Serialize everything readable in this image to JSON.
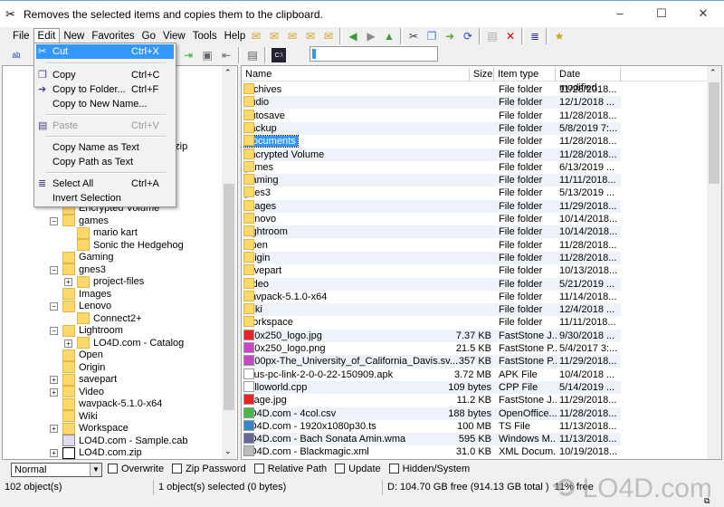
{
  "window": {
    "title": "Removes the selected items and copies them to the clipboard.",
    "minimize": "–",
    "maximize": "☐",
    "close": "✕"
  },
  "menubar": [
    "File",
    "Edit",
    "New",
    "Favorites",
    "Go",
    "View",
    "Tools",
    "Help"
  ],
  "address": {
    "value": ""
  },
  "edit_menu": {
    "items": [
      {
        "label": "Cut",
        "shortcut": "Ctrl+X",
        "icon": "scissors-icon",
        "state": "highlighted"
      },
      {
        "label": "Copy",
        "shortcut": "Ctrl+C",
        "icon": "copy-icon"
      },
      {
        "label": "Copy to Folder...",
        "shortcut": "Ctrl+F",
        "icon": "folder-copy-icon"
      },
      {
        "label": "Copy to New Name...",
        "shortcut": ""
      },
      {
        "label": "Paste",
        "shortcut": "Ctrl+V",
        "icon": "paste-icon",
        "state": "disabled"
      },
      {
        "label": "Copy Name as Text",
        "shortcut": ""
      },
      {
        "label": "Copy Path as Text",
        "shortcut": ""
      },
      {
        "label": "Select All",
        "shortcut": "Ctrl+A",
        "icon": "select-all-icon"
      },
      {
        "label": "Invert Selection",
        "shortcut": ""
      }
    ]
  },
  "tree": {
    "partial_item": "e.zip",
    "items": [
      {
        "label": "Encrypted Volume",
        "level": 1
      },
      {
        "label": "games",
        "level": 1,
        "expander": "−"
      },
      {
        "label": "mario kart",
        "level": 2
      },
      {
        "label": "Sonic the Hedgehog",
        "level": 2
      },
      {
        "label": "Gaming",
        "level": 1
      },
      {
        "label": "gnes3",
        "level": 1,
        "expander": "−"
      },
      {
        "label": "project-files",
        "level": 2,
        "expander": "+"
      },
      {
        "label": "Images",
        "level": 1
      },
      {
        "label": "Lenovo",
        "level": 1,
        "expander": "−"
      },
      {
        "label": "Connect2+",
        "level": 2
      },
      {
        "label": "Lightroom",
        "level": 1,
        "expander": "−"
      },
      {
        "label": "LO4D.com - Catalog",
        "level": 2,
        "expander": "+"
      },
      {
        "label": "Open",
        "level": 1
      },
      {
        "label": "Origin",
        "level": 1
      },
      {
        "label": "savepart",
        "level": 1,
        "expander": "+"
      },
      {
        "label": "Video",
        "level": 1,
        "expander": "+"
      },
      {
        "label": "wavpack-5.1.0-x64",
        "level": 1
      },
      {
        "label": "Wiki",
        "level": 1
      },
      {
        "label": "Workspace",
        "level": 1,
        "expander": "+"
      },
      {
        "label": "LO4D.com - Sample.cab",
        "level": 1,
        "icon": "cab"
      },
      {
        "label": "LO4D.com.zip",
        "level": 1,
        "expander": "+",
        "icon": "7z"
      }
    ]
  },
  "list": {
    "columns": [
      "Name",
      "Size",
      "Item type",
      "Date modified"
    ],
    "rows": [
      [
        "Archives",
        "",
        "File folder",
        "11/28/2018...",
        "folder"
      ],
      [
        "Audio",
        "",
        "File folder",
        "12/1/2018 ...",
        "folder"
      ],
      [
        "Autosave",
        "",
        "File folder",
        "11/28/2018...",
        "folder"
      ],
      [
        "Backup",
        "",
        "File folder",
        "5/8/2019 7:...",
        "folder"
      ],
      [
        "Documents",
        "",
        "File folder",
        "11/28/2018...",
        "folder"
      ],
      [
        "Encrypted Volume",
        "",
        "File folder",
        "11/28/2018...",
        "folder"
      ],
      [
        "games",
        "",
        "File folder",
        "6/13/2019 ...",
        "folder"
      ],
      [
        "Gaming",
        "",
        "File folder",
        "11/11/2018...",
        "folder"
      ],
      [
        "gnes3",
        "",
        "File folder",
        "5/13/2019 ...",
        "folder"
      ],
      [
        "Images",
        "",
        "File folder",
        "11/29/2018...",
        "folder"
      ],
      [
        "Lenovo",
        "",
        "File folder",
        "10/14/2018...",
        "folder"
      ],
      [
        "Lightroom",
        "",
        "File folder",
        "10/14/2018...",
        "folder"
      ],
      [
        "Open",
        "",
        "File folder",
        "11/28/2018...",
        "folder"
      ],
      [
        "Origin",
        "",
        "File folder",
        "11/28/2018...",
        "folder"
      ],
      [
        "savepart",
        "",
        "File folder",
        "10/13/2018...",
        "folder"
      ],
      [
        "Video",
        "",
        "File folder",
        "5/21/2019 ...",
        "folder"
      ],
      [
        "wavpack-5.1.0-x64",
        "",
        "File folder",
        "11/14/2018...",
        "folder"
      ],
      [
        "Wiki",
        "",
        "File folder",
        "12/4/2018 ...",
        "folder"
      ],
      [
        "Workspace",
        "",
        "File folder",
        "11/11/2018...",
        "folder"
      ],
      [
        "250x250_logo.jpg",
        "7.37 KB",
        "FastStone J...",
        "9/30/2018 ...",
        "jpg"
      ],
      [
        "250x250_logo.png",
        "21.5 KB",
        "FastStone P...",
        "5/4/2017 3:...",
        "png"
      ],
      [
        "1200px-The_University_of_California_Davis.sv...",
        "357 KB",
        "FastStone P...",
        "11/29/2018...",
        "png"
      ],
      [
        "asus-pc-link-2-0-0-22-150909.apk",
        "3.72 MB",
        "APK File",
        "10/4/2018 ...",
        "file"
      ],
      [
        "helloworld.cpp",
        "109 bytes",
        "CPP File",
        "5/14/2019 ...",
        "file"
      ],
      [
        "image.jpg",
        "11.2 KB",
        "FastStone J...",
        "11/29/2018...",
        "jpg"
      ],
      [
        "LO4D.com - 4col.csv",
        "188 bytes",
        "OpenOffice....",
        "11/28/2018...",
        "csv"
      ],
      [
        "LO4D.com - 1920x1080p30.ts",
        "100 MB",
        "TS File",
        "11/13/2018...",
        "video"
      ],
      [
        "LO4D.com - Bach Sonata Amin.wma",
        "595 KB",
        "Windows M...",
        "11/13/2018...",
        "audio"
      ],
      [
        "LO4D.com - Blackmagic.xml",
        "31.0 KB",
        "XML Docum...",
        "10/19/2018...",
        "xml"
      ]
    ],
    "selected": 4
  },
  "options": {
    "mode": "Normal",
    "checks": [
      "Overwrite",
      "Zip Password",
      "Relative Path",
      "Update",
      "Hidden/System"
    ]
  },
  "status": {
    "objects": "102 object(s)",
    "selected": "1 object(s) selected (0 bytes)",
    "disk": "D: 104.70 GB free (914.13 GB total )  11% free"
  },
  "watermark": "LO4D.com",
  "colors": {
    "selection": "#3399ff",
    "folder": "#ffd86b",
    "alt_row": "#eef3fa"
  }
}
